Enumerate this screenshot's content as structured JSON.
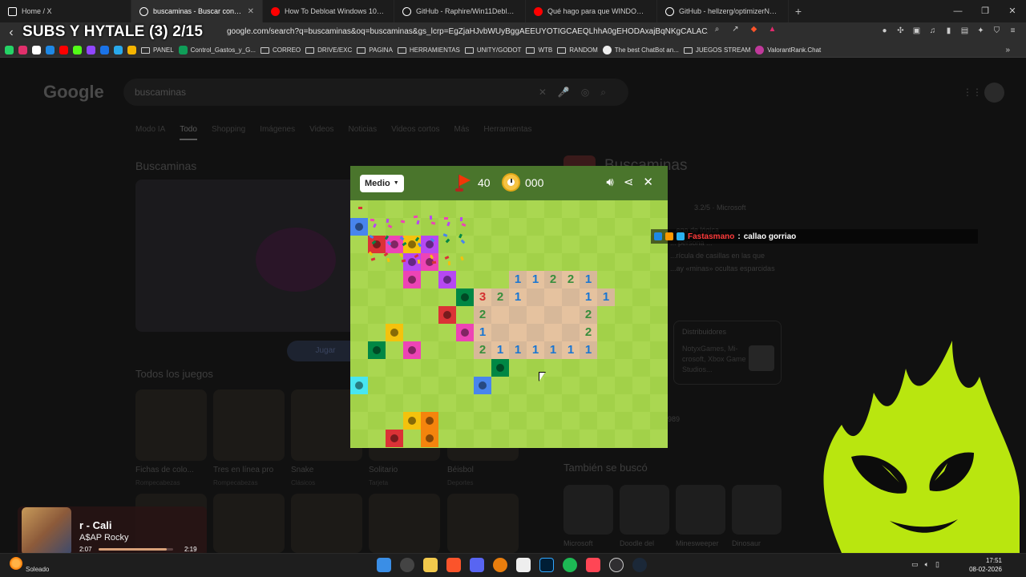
{
  "browser": {
    "tabs": [
      {
        "title": "Home / X",
        "icon": "x-logo-icon",
        "color": "#ffffff"
      },
      {
        "title": "buscaminas - Buscar con Goo",
        "icon": "google-icon",
        "color": "#ffffff",
        "active": true
      },
      {
        "title": "How To Debloat Windows 10/11 (Fu",
        "icon": "youtube-icon",
        "color": "#ff0000"
      },
      {
        "title": "GitHub - Raphire/Win11Debloat: A si",
        "icon": "github-icon",
        "color": "#ffffff"
      },
      {
        "title": "Qué hago para que WINDOWS vaya",
        "icon": "youtube-icon",
        "color": "#ff0000"
      },
      {
        "title": "GitHub - hellzerg/optimizerNXT: The",
        "icon": "github-icon",
        "color": "#ffffff"
      }
    ],
    "new_tab": "+",
    "url": "google.com/search?q=buscaminas&oq=buscaminas&gs_lcrp=EgZjaHJvbWUyBggAEEUYOTIGCAEQLhhA0gEHODAxajBqNKgCALACAQ&sourcei...",
    "overlay_title": "SUBS Y HYTALE (3) 2/15",
    "bookmarks": [
      {
        "label": "PANEL",
        "type": "folder"
      },
      {
        "label": "Control_Gastos_y_G...",
        "type": "sheet"
      },
      {
        "label": "CORREO",
        "type": "folder"
      },
      {
        "label": "DRIVE/EXC",
        "type": "folder"
      },
      {
        "label": "PAGINA",
        "type": "folder"
      },
      {
        "label": "HERRAMIENTAS",
        "type": "folder"
      },
      {
        "label": "UNITY/GODOT",
        "type": "folder"
      },
      {
        "label": "WTB",
        "type": "folder"
      },
      {
        "label": "RANDOM",
        "type": "folder"
      },
      {
        "label": "The best ChatBot an...",
        "type": "link"
      },
      {
        "label": "JUEGOS STREAM",
        "type": "folder"
      },
      {
        "label": "ValorantRank.Chat",
        "type": "link"
      }
    ]
  },
  "google": {
    "logo": "Google",
    "query": "buscaminas",
    "tabs": [
      "Modo IA",
      "Todo",
      "Shopping",
      "Imágenes",
      "Videos",
      "Noticias",
      "Videos cortos",
      "Más",
      "Herramientas"
    ],
    "active_tab": "Todo",
    "section_title": "Buscaminas",
    "play_label": "Jugar",
    "all_games_title": "Todos los juegos",
    "games": [
      {
        "name": "Fichas de colo...",
        "cat": "Rompecabezas"
      },
      {
        "name": "Tres en línea pro",
        "cat": "Rompecabezas"
      },
      {
        "name": "Snake",
        "cat": "Clásicos"
      },
      {
        "name": "Solitario",
        "cat": "Tarjeta"
      },
      {
        "name": "Béisbol",
        "cat": "Deportes"
      }
    ],
    "kp": {
      "title": "Buscaminas",
      "rating": "3.2/5 · Microsoft",
      "desc_lines": [
        "...ego de lógica ...",
        "... persona ...",
        "...rícula de casillas en las que",
        "...ay «minas» ocultas esparcidas"
      ],
      "dist_label": "Distribuidores",
      "dist_value": "NotyxGames, Mi-crosoft, Xbox Game Studios...",
      "year_fragment": "989",
      "related_title": "También se buscó",
      "related": [
        "Microsoft",
        "Doodle del",
        "Minesweeper",
        "Dinosaur"
      ]
    }
  },
  "minesweeper": {
    "difficulty": "Medio",
    "flags": "40",
    "timer": "000",
    "icons": [
      "sound-icon",
      "share-icon",
      "close-icon"
    ],
    "numbers": [
      {
        "r": 4,
        "c": 9,
        "v": "1"
      },
      {
        "r": 4,
        "c": 10,
        "v": "1"
      },
      {
        "r": 4,
        "c": 11,
        "v": "2"
      },
      {
        "r": 4,
        "c": 12,
        "v": "2"
      },
      {
        "r": 4,
        "c": 13,
        "v": "1"
      },
      {
        "r": 5,
        "c": 7,
        "v": "3"
      },
      {
        "r": 5,
        "c": 8,
        "v": "2"
      },
      {
        "r": 5,
        "c": 9,
        "v": "1"
      },
      {
        "r": 5,
        "c": 13,
        "v": "1"
      },
      {
        "r": 5,
        "c": 14,
        "v": "1"
      },
      {
        "r": 6,
        "c": 7,
        "v": "2"
      },
      {
        "r": 6,
        "c": 13,
        "v": "2"
      },
      {
        "r": 7,
        "c": 7,
        "v": "1"
      },
      {
        "r": 7,
        "c": 13,
        "v": "2"
      },
      {
        "r": 8,
        "c": 7,
        "v": "2"
      },
      {
        "r": 8,
        "c": 8,
        "v": "1"
      },
      {
        "r": 8,
        "c": 9,
        "v": "1"
      },
      {
        "r": 8,
        "c": 10,
        "v": "1"
      },
      {
        "r": 8,
        "c": 11,
        "v": "1"
      },
      {
        "r": 8,
        "c": 12,
        "v": "1"
      },
      {
        "r": 8,
        "c": 13,
        "v": "1"
      }
    ],
    "revealed": [
      [
        4,
        9
      ],
      [
        4,
        10
      ],
      [
        4,
        11
      ],
      [
        4,
        12
      ],
      [
        4,
        13
      ],
      [
        5,
        7
      ],
      [
        5,
        8
      ],
      [
        5,
        9
      ],
      [
        5,
        10
      ],
      [
        5,
        11
      ],
      [
        5,
        12
      ],
      [
        5,
        13
      ],
      [
        5,
        14
      ],
      [
        6,
        7
      ],
      [
        6,
        8
      ],
      [
        6,
        9
      ],
      [
        6,
        10
      ],
      [
        6,
        11
      ],
      [
        6,
        12
      ],
      [
        6,
        13
      ],
      [
        7,
        7
      ],
      [
        7,
        8
      ],
      [
        7,
        9
      ],
      [
        7,
        10
      ],
      [
        7,
        11
      ],
      [
        7,
        12
      ],
      [
        7,
        13
      ],
      [
        8,
        7
      ],
      [
        8,
        8
      ],
      [
        8,
        9
      ],
      [
        8,
        10
      ],
      [
        8,
        11
      ],
      [
        8,
        12
      ],
      [
        8,
        13
      ]
    ],
    "mines": [
      {
        "r": 1,
        "c": 0,
        "color": "#4885ed"
      },
      {
        "r": 2,
        "c": 1,
        "color": "#db3236"
      },
      {
        "r": 2,
        "c": 2,
        "color": "#ed44b5"
      },
      {
        "r": 2,
        "c": 3,
        "color": "#f4c20d"
      },
      {
        "r": 2,
        "c": 4,
        "color": "#b648f2"
      },
      {
        "r": 3,
        "c": 3,
        "color": "#b648f2"
      },
      {
        "r": 3,
        "c": 4,
        "color": "#ed44b5"
      },
      {
        "r": 4,
        "c": 3,
        "color": "#ed44b5"
      },
      {
        "r": 4,
        "c": 5,
        "color": "#b648f2"
      },
      {
        "r": 5,
        "c": 6,
        "color": "#008744"
      },
      {
        "r": 6,
        "c": 5,
        "color": "#db3236"
      },
      {
        "r": 7,
        "c": 2,
        "color": "#f4c20d"
      },
      {
        "r": 7,
        "c": 6,
        "color": "#ed44b5"
      },
      {
        "r": 8,
        "c": 1,
        "color": "#008744"
      },
      {
        "r": 8,
        "c": 3,
        "color": "#ed44b5"
      },
      {
        "r": 9,
        "c": 8,
        "color": "#008744"
      },
      {
        "r": 10,
        "c": 0,
        "color": "#48e6f1"
      },
      {
        "r": 10,
        "c": 7,
        "color": "#4885ed"
      },
      {
        "r": 12,
        "c": 3,
        "color": "#f4c20d"
      },
      {
        "r": 12,
        "c": 4,
        "color": "#f4840d"
      },
      {
        "r": 13,
        "c": 2,
        "color": "#db3236"
      },
      {
        "r": 13,
        "c": 4,
        "color": "#f4840d"
      }
    ]
  },
  "chat": {
    "user": "Fastasmano",
    "sep": " : ",
    "message": "callao gorriao"
  },
  "music": {
    "track": "r - Cali",
    "artist": "A$AP Rocky",
    "elapsed": "2:07",
    "total": "2:19",
    "progress": 0.91
  },
  "taskbar": {
    "weather": "Soleado",
    "time": "17:51",
    "date": "08-02-2026"
  }
}
